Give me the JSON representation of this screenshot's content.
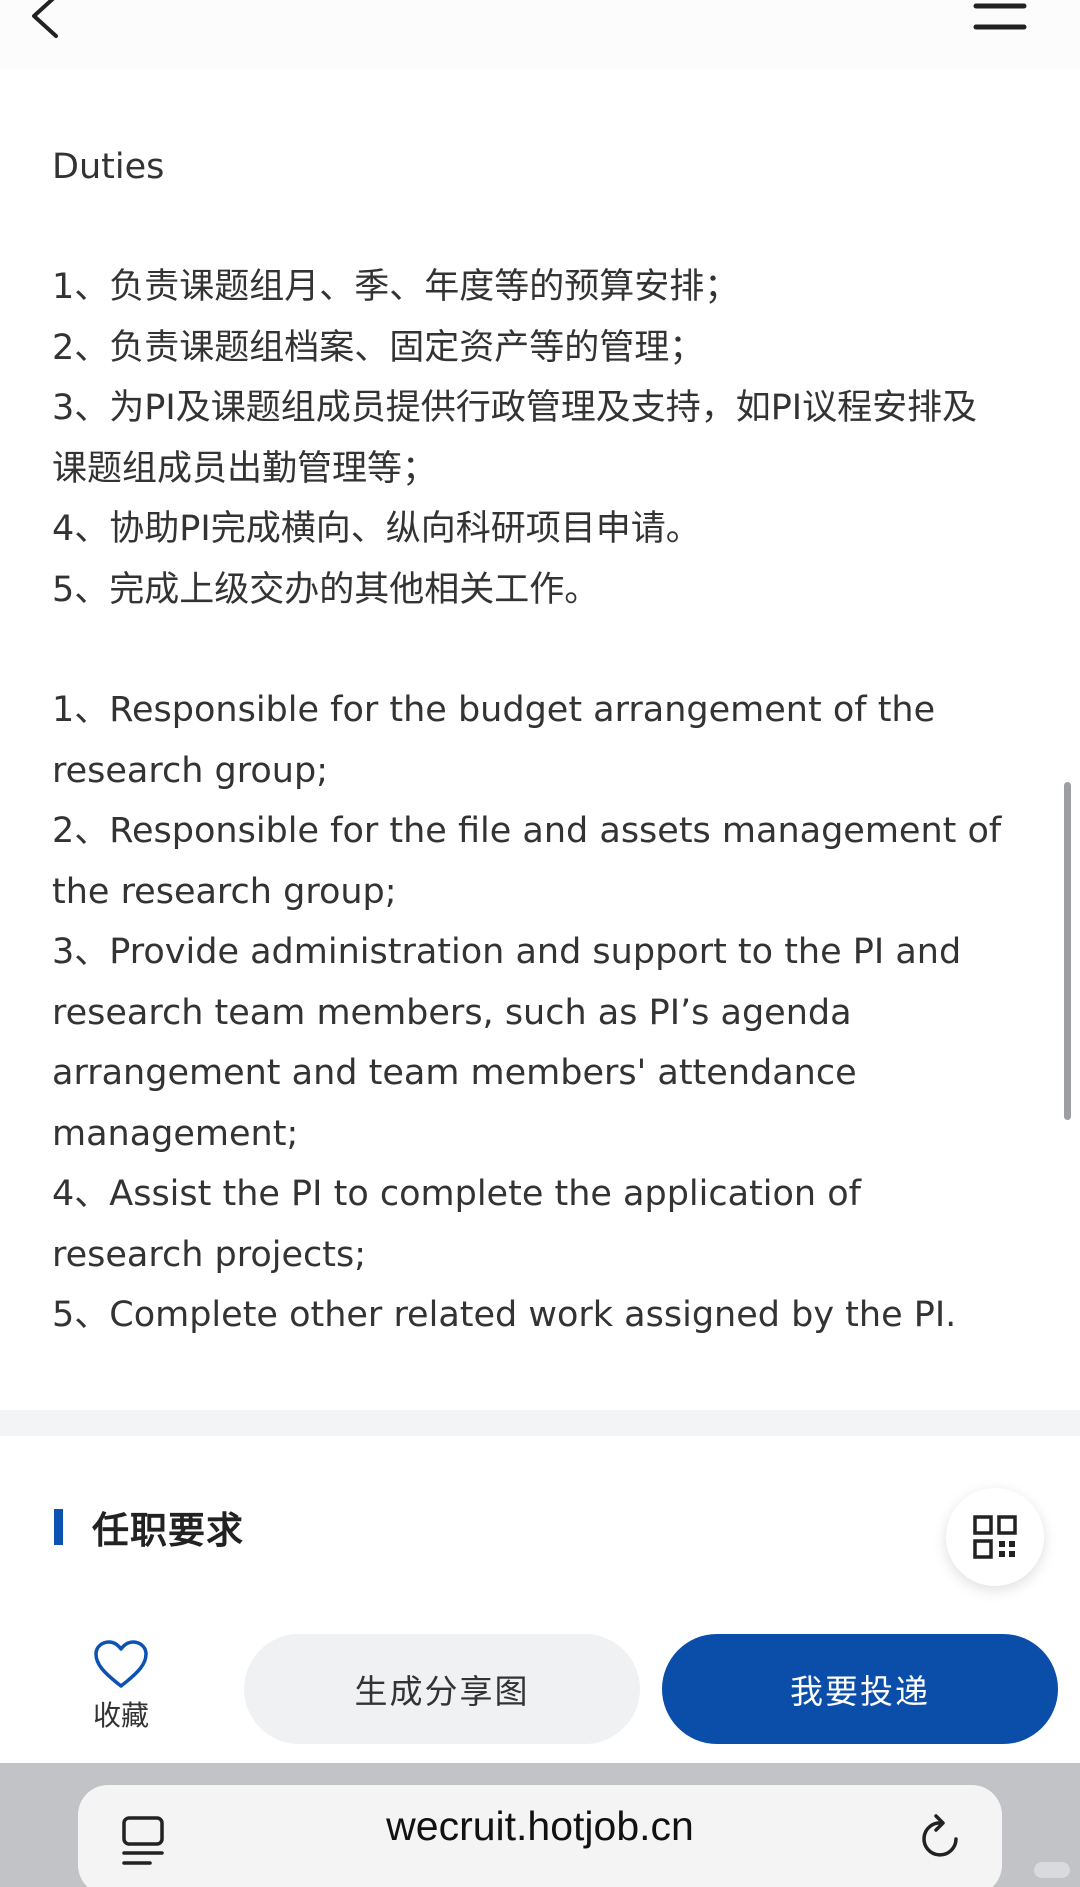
{
  "content": {
    "section_label": "Duties",
    "duties_cn": [
      "1、负责课题组月、季、年度等的预算安排；",
      "2、负责课题组档案、固定资产等的管理；",
      "3、为PI及课题组成员提供行政管理及支持，如PI议程安排及",
      "课题组成员出勤管理等；",
      "4、协助PI完成横向、纵向科研项目申请。",
      "5、完成上级交办的其他相关工作。"
    ],
    "duties_en": [
      "1、Responsible for the budget arrangement of the",
      "research group;",
      "2、Responsible for the file and assets management of",
      "the research group;",
      "3、Provide administration and support to the PI and",
      "research team members, such as PI’s agenda",
      "arrangement and team members' attendance",
      "management;",
      "4、Assist the PI to complete the application of",
      "research projects;",
      "5、Complete other related work assigned by the PI."
    ]
  },
  "requirements": {
    "title": "任职要求"
  },
  "actions": {
    "favorite_label": "收藏",
    "share_label": "生成分享图",
    "apply_label": "我要投递"
  },
  "browser": {
    "url": "wecruit.hotjob.cn"
  },
  "colors": {
    "brand_blue": "#0b4ea9",
    "accent_bar": "#0b52b3"
  },
  "icons": [
    "back-chevron-icon",
    "menu-icon",
    "qr-code-icon",
    "heart-icon",
    "reader-icon",
    "reload-icon"
  ]
}
